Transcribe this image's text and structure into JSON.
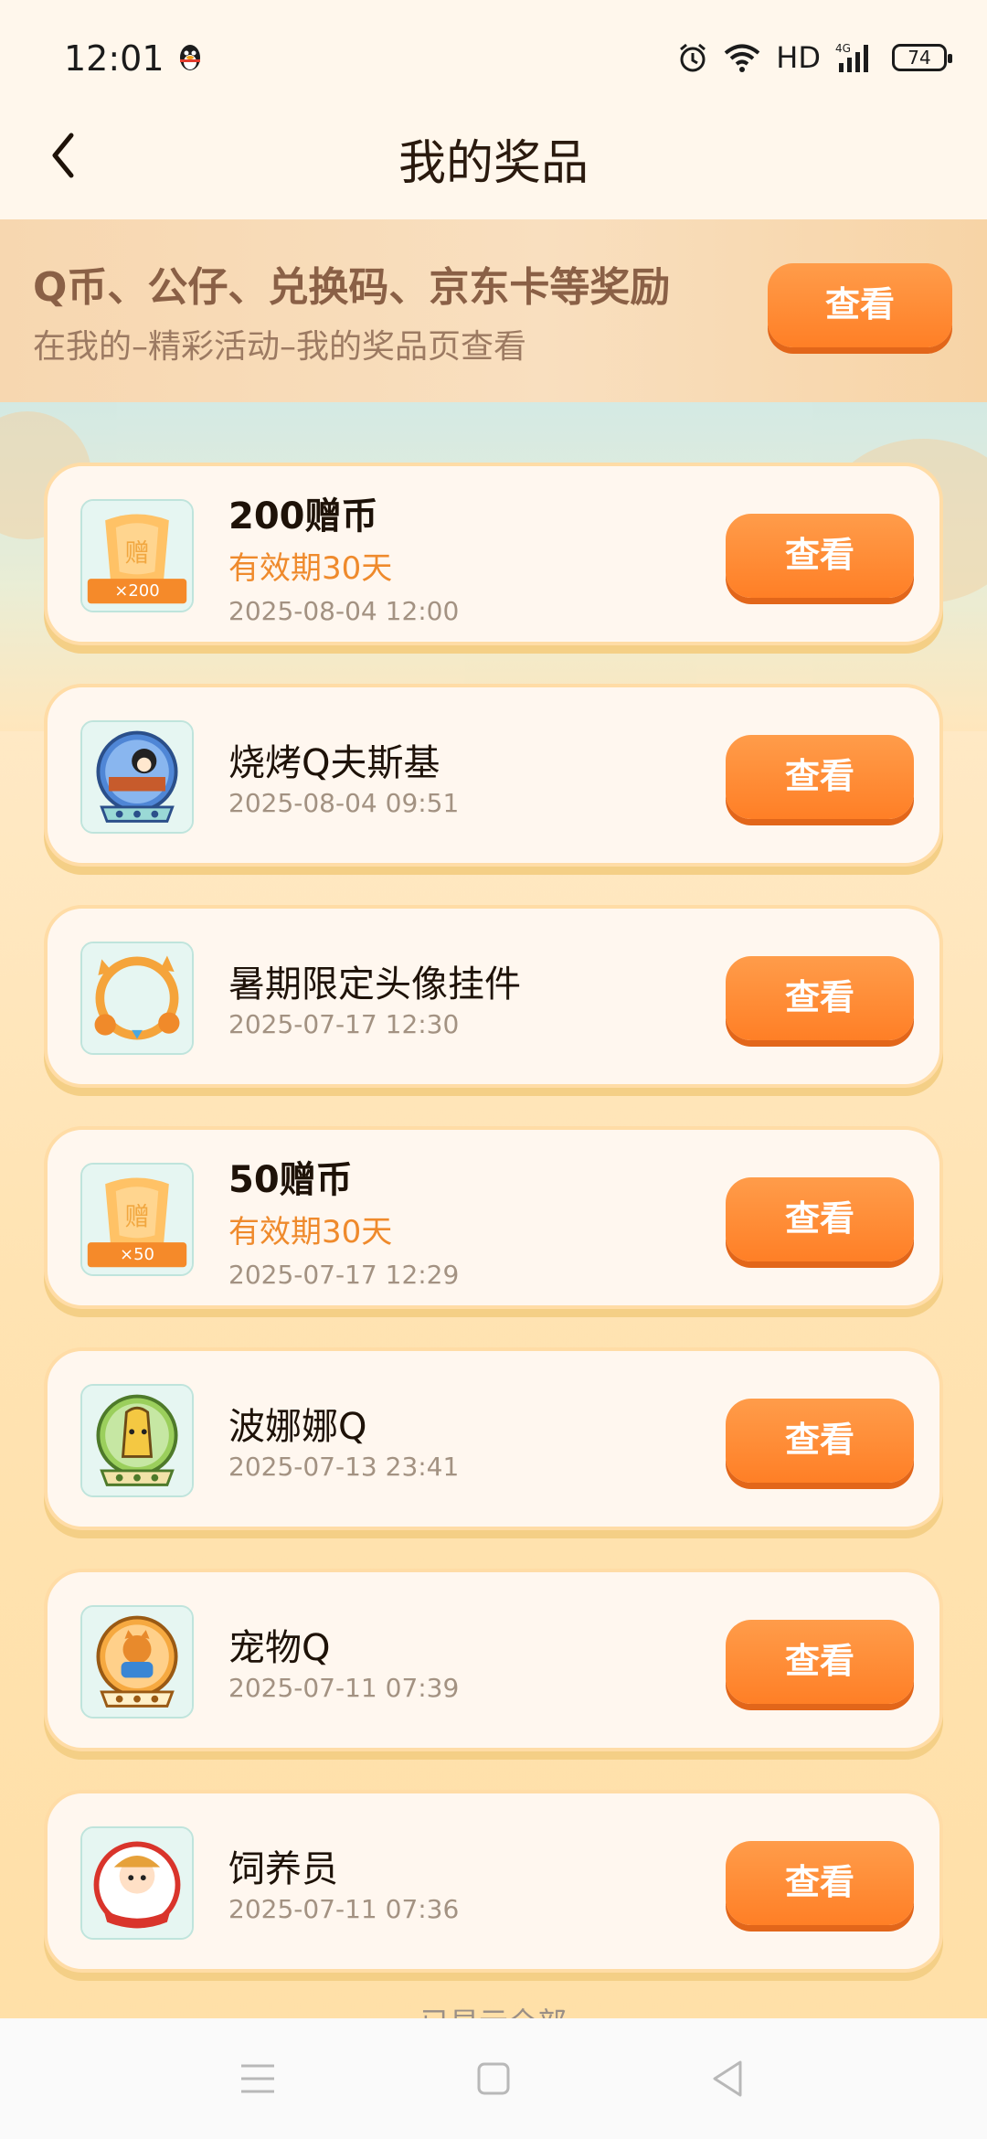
{
  "status_bar": {
    "time": "12:01",
    "hd": "HD",
    "network": "4G",
    "battery": "74"
  },
  "header": {
    "title": "我的奖品"
  },
  "banner": {
    "title": "Q币、公仔、兑换码、京东卡等奖励",
    "subtitle": "在我的–精彩活动–我的奖品页查看",
    "button_label": "查看"
  },
  "prizes": [
    {
      "name": "200赠币",
      "validity": "有效期30天",
      "date": "2025-08-04 12:00",
      "badge": "×200",
      "icon": "gift-coin-icon",
      "button_label": "查看"
    },
    {
      "name": "烧烤Q夫斯基",
      "date": "2025-08-04 09:51",
      "icon": "snowglobe-bbq-icon",
      "button_label": "查看"
    },
    {
      "name": "暑期限定头像挂件",
      "date": "2025-07-17 12:30",
      "icon": "avatar-frame-icon",
      "button_label": "查看"
    },
    {
      "name": "50赠币",
      "validity": "有效期30天",
      "date": "2025-07-17 12:29",
      "badge": "×50",
      "icon": "gift-coin-icon",
      "button_label": "查看"
    },
    {
      "name": "波娜娜Q",
      "date": "2025-07-13 23:41",
      "icon": "snowglobe-banana-icon",
      "button_label": "查看"
    },
    {
      "name": "宠物Q",
      "date": "2025-07-11 07:39",
      "icon": "snowglobe-pet-icon",
      "button_label": "查看"
    },
    {
      "name": "饲养员",
      "date": "2025-07-11 07:36",
      "icon": "keeper-badge-icon",
      "button_label": "查看"
    }
  ],
  "footer": {
    "text": "已显示全部"
  },
  "colors": {
    "accent": "#ff8a33",
    "validity": "#ef8a2c",
    "background": "#ffe6bb"
  }
}
